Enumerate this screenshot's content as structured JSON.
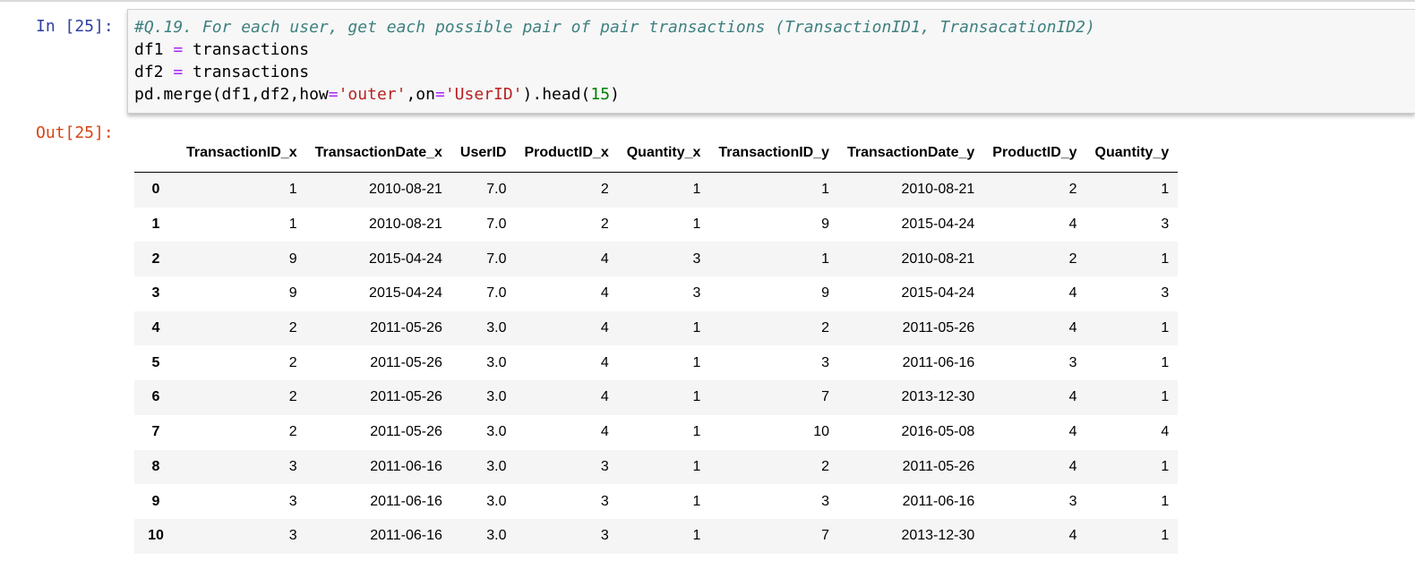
{
  "input_prompt": "In [25]:",
  "output_prompt": "Out[25]:",
  "code": {
    "comment": "#Q.19. For each user, get each possible pair of pair transactions (TransactionID1, TransacationID2)",
    "line2_var": "df1",
    "line2_op": "=",
    "line2_val": "transactions",
    "line3_var": "df2",
    "line3_op": "=",
    "line3_val": "transactions",
    "line4_a": "pd.merge(df1,df2,how",
    "line4_eq1": "=",
    "line4_str1": "'outer'",
    "line4_b": ",on",
    "line4_eq2": "=",
    "line4_str2": "'UserID'",
    "line4_c": ").head(",
    "line4_num": "15",
    "line4_d": ")"
  },
  "table": {
    "columns": [
      "",
      "TransactionID_x",
      "TransactionDate_x",
      "UserID",
      "ProductID_x",
      "Quantity_x",
      "TransactionID_y",
      "TransactionDate_y",
      "ProductID_y",
      "Quantity_y"
    ],
    "rows": [
      [
        "0",
        "1",
        "2010-08-21",
        "7.0",
        "2",
        "1",
        "1",
        "2010-08-21",
        "2",
        "1"
      ],
      [
        "1",
        "1",
        "2010-08-21",
        "7.0",
        "2",
        "1",
        "9",
        "2015-04-24",
        "4",
        "3"
      ],
      [
        "2",
        "9",
        "2015-04-24",
        "7.0",
        "4",
        "3",
        "1",
        "2010-08-21",
        "2",
        "1"
      ],
      [
        "3",
        "9",
        "2015-04-24",
        "7.0",
        "4",
        "3",
        "9",
        "2015-04-24",
        "4",
        "3"
      ],
      [
        "4",
        "2",
        "2011-05-26",
        "3.0",
        "4",
        "1",
        "2",
        "2011-05-26",
        "4",
        "1"
      ],
      [
        "5",
        "2",
        "2011-05-26",
        "3.0",
        "4",
        "1",
        "3",
        "2011-06-16",
        "3",
        "1"
      ],
      [
        "6",
        "2",
        "2011-05-26",
        "3.0",
        "4",
        "1",
        "7",
        "2013-12-30",
        "4",
        "1"
      ],
      [
        "7",
        "2",
        "2011-05-26",
        "3.0",
        "4",
        "1",
        "10",
        "2016-05-08",
        "4",
        "4"
      ],
      [
        "8",
        "3",
        "2011-06-16",
        "3.0",
        "3",
        "1",
        "2",
        "2011-05-26",
        "4",
        "1"
      ],
      [
        "9",
        "3",
        "2011-06-16",
        "3.0",
        "3",
        "1",
        "3",
        "2011-06-16",
        "3",
        "1"
      ],
      [
        "10",
        "3",
        "2011-06-16",
        "3.0",
        "3",
        "1",
        "7",
        "2013-12-30",
        "4",
        "1"
      ]
    ]
  }
}
